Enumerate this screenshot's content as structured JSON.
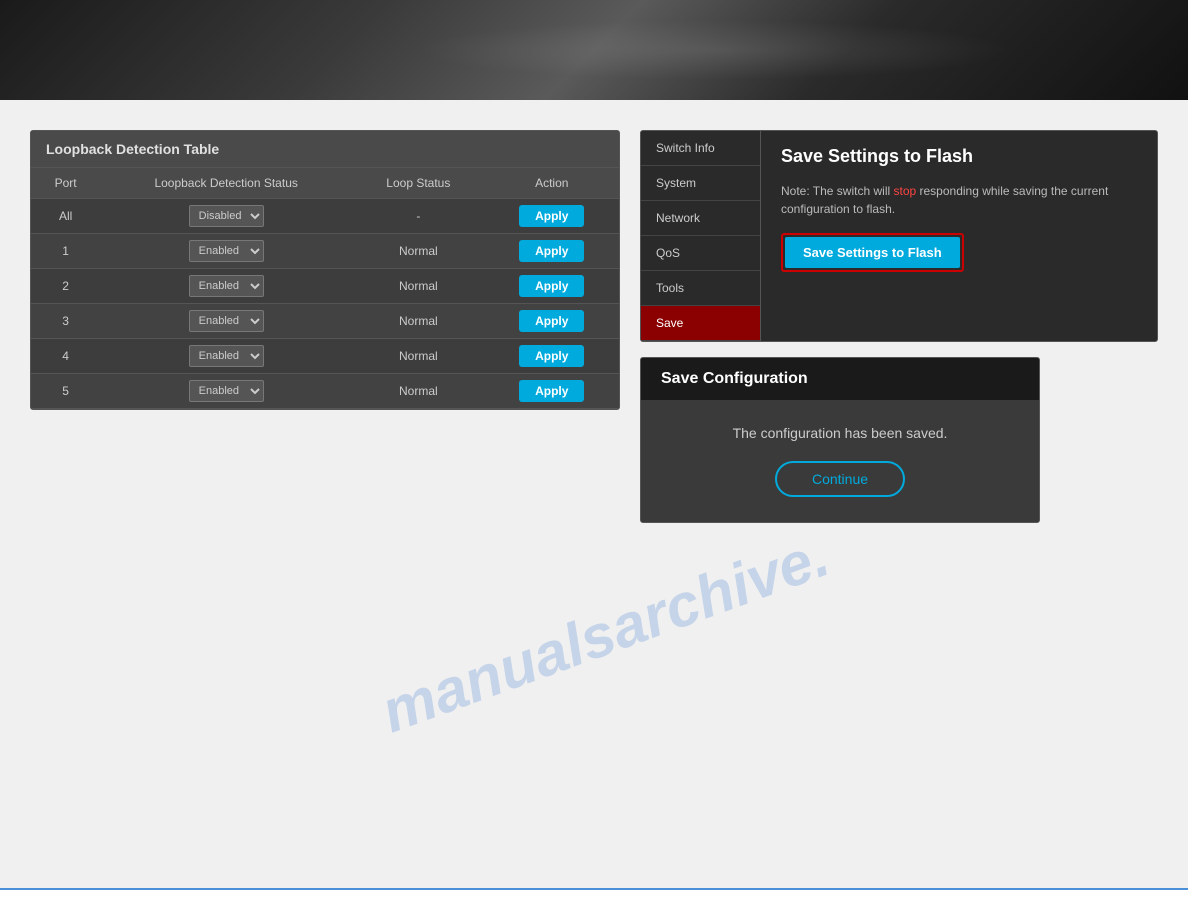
{
  "header": {
    "alt": "Device banner"
  },
  "left_panel": {
    "table_title": "Loopback Detection Table",
    "columns": {
      "port": "Port",
      "status": "Loopback Detection Status",
      "loop": "Loop Status",
      "action": "Action"
    },
    "rows": [
      {
        "port": "All",
        "status": "Disabled",
        "loop": "-",
        "action": "Apply"
      },
      {
        "port": "1",
        "status": "Enabled",
        "loop": "Normal",
        "action": "Apply"
      },
      {
        "port": "2",
        "status": "Enabled",
        "loop": "Normal",
        "action": "Apply"
      },
      {
        "port": "3",
        "status": "Enabled",
        "loop": "Normal",
        "action": "Apply"
      },
      {
        "port": "4",
        "status": "Enabled",
        "loop": "Normal",
        "action": "Apply"
      },
      {
        "port": "5",
        "status": "Enabled",
        "loop": "Normal",
        "action": "Apply"
      }
    ],
    "status_options": [
      "Disabled",
      "Enabled"
    ]
  },
  "right_panel": {
    "save_flash": {
      "sidebar_items": [
        {
          "label": "Switch Info",
          "active": false
        },
        {
          "label": "System",
          "active": false
        },
        {
          "label": "Network",
          "active": false
        },
        {
          "label": "QoS",
          "active": false
        },
        {
          "label": "Tools",
          "active": false
        },
        {
          "label": "Save",
          "active": true
        }
      ],
      "title": "Save Settings to Flash",
      "note": "Note: The switch will stop responding while saving the current configuration to flash.",
      "button_label": "Save Settings to Flash"
    },
    "save_config": {
      "title": "Save Configuration",
      "message": "The configuration has been saved.",
      "continue_label": "Continue"
    }
  },
  "watermark": {
    "line1": "manualsarchive."
  }
}
